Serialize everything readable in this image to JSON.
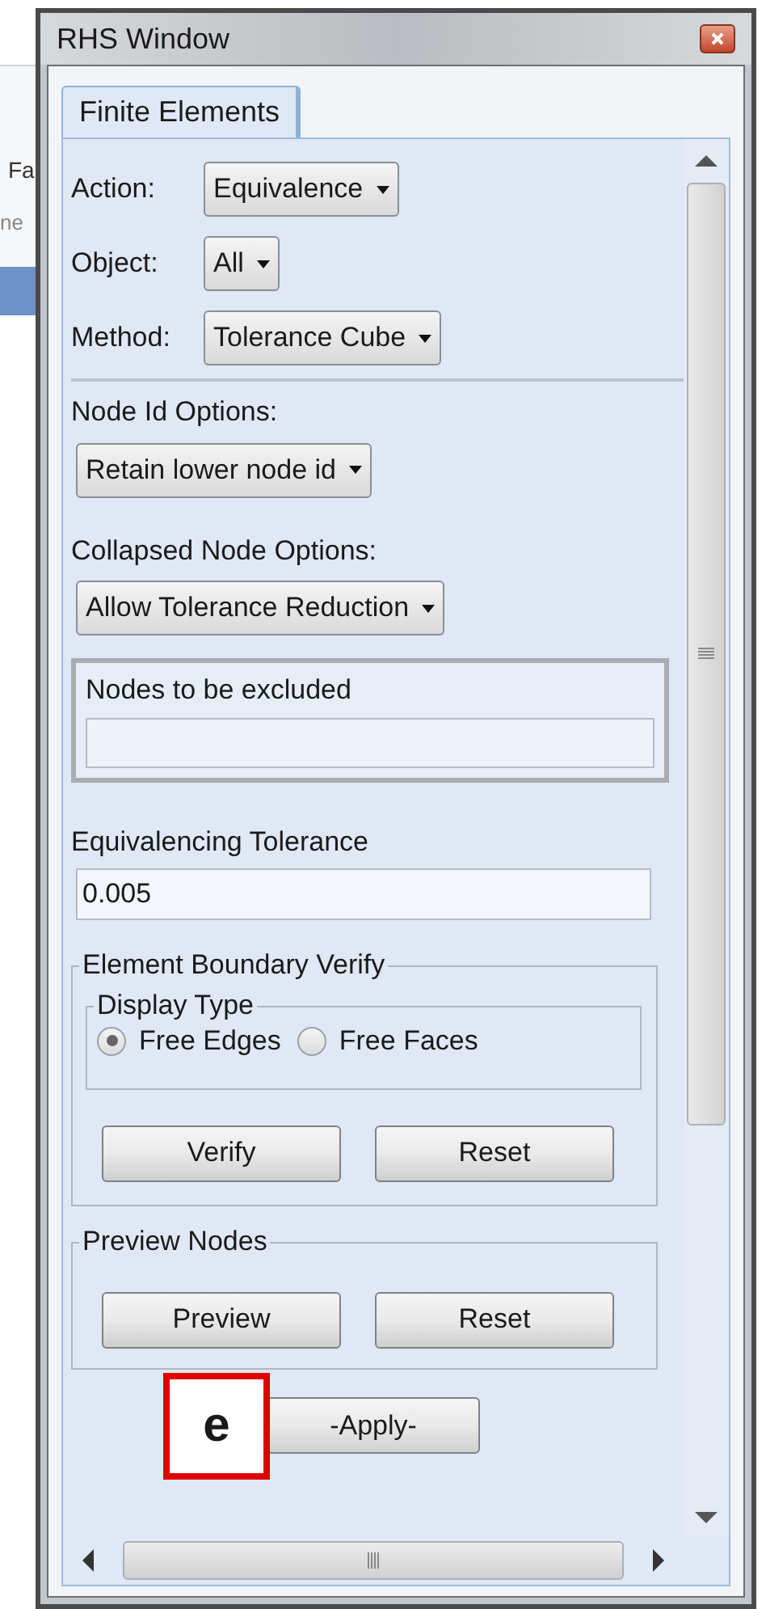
{
  "background_window": {
    "texts": [
      "Fa",
      "ne"
    ]
  },
  "window": {
    "title": "RHS Window"
  },
  "tabs": [
    {
      "label": "Finite Elements",
      "selected": true
    }
  ],
  "fields": [
    {
      "label": "Action:",
      "value": "Equivalence"
    },
    {
      "label": "Object:",
      "value": "All"
    },
    {
      "label": "Method:",
      "value": "Tolerance Cube"
    }
  ],
  "node_id_options": {
    "label": "Node Id Options:",
    "value": "Retain lower node id"
  },
  "collapsed_node_options": {
    "label": "Collapsed Node Options:",
    "value": "Allow Tolerance Reduction"
  },
  "excluded_nodes": {
    "label": "Nodes to be excluded"
  },
  "tolerance": {
    "label": "Equivalencing Tolerance",
    "value": "0.005"
  },
  "boundary_verify": {
    "title": "Element Boundary Verify",
    "display_type": {
      "title": "Display Type",
      "options": [
        {
          "label": "Free Edges",
          "selected": true
        },
        {
          "label": "Free Faces",
          "selected": false
        }
      ]
    },
    "buttons": [
      "Verify",
      "Reset"
    ]
  },
  "preview_nodes": {
    "title": "Preview Nodes",
    "buttons": [
      "Preview",
      "Reset"
    ]
  },
  "apply_button": "-Apply-",
  "callout": {
    "label": "e"
  }
}
